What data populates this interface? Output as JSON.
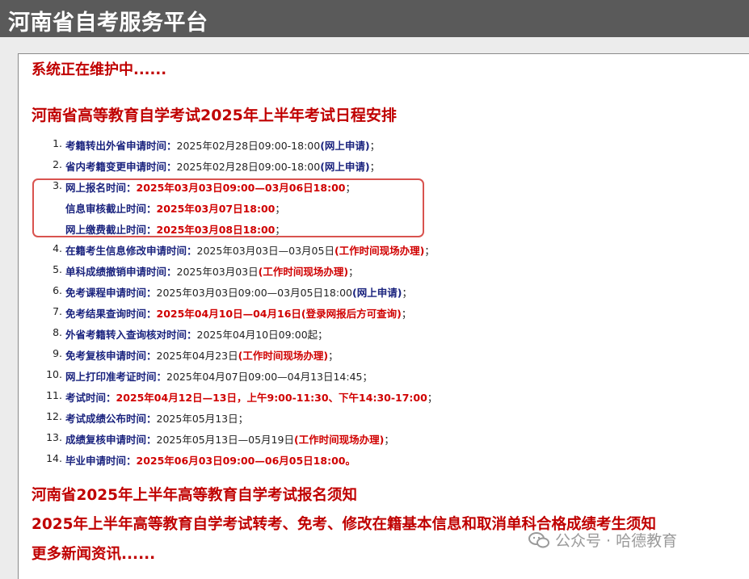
{
  "header": {
    "title": "河南省自考服务平台"
  },
  "notice": "系统正在维护中......",
  "schedule_title": "河南省高等教育自学考试2025年上半年考试日程安排",
  "schedule": [
    {
      "num": "1.",
      "label": "考籍转出外省申请时间：",
      "value": "2025年02月28日09:00-18:00",
      "note": "(网上申请)",
      "end": "；"
    },
    {
      "num": "2.",
      "label": "省内考籍变更申请时间：",
      "value": "2025年02月28日09:00-18:00",
      "note": "(网上申请)",
      "end": "；"
    },
    {
      "num": "3.",
      "label": "网上报名时间：",
      "value": "2025年03月03日09:00—03月06日18:00",
      "end": "；"
    },
    {
      "num": "",
      "label": "信息审核截止时间：",
      "value": "2025年03月07日18:00",
      "end": "；"
    },
    {
      "num": "",
      "label": "网上缴费截止时间：",
      "value": "2025年03月08日18:00",
      "end": "；"
    },
    {
      "num": "4.",
      "label": "在籍考生信息修改申请时间：",
      "value": "2025年03月03日—03月05日",
      "note": "(工作时间现场办理)",
      "end": "；"
    },
    {
      "num": "5.",
      "label": "单科成绩撤销申请时间：",
      "value": "2025年03月03日",
      "note": "(工作时间现场办理)",
      "end": "；"
    },
    {
      "num": "6.",
      "label": "免考课程申请时间：",
      "value": "2025年03月03日09:00—03月05日18:00",
      "note": "(网上申请)",
      "end": "；"
    },
    {
      "num": "7.",
      "label": "免考结果查询时间：",
      "value": "2025年04月10日—04月16日",
      "note": "(登录网报后方可查询)",
      "end": "；"
    },
    {
      "num": "8.",
      "label": "外省考籍转入查询核对时间：",
      "value": "2025年04月10日09:00起",
      "end": "；"
    },
    {
      "num": "9.",
      "label": "免考复核申请时间：",
      "value": "2025年04月23日",
      "note": "(工作时间现场办理)",
      "end": "；"
    },
    {
      "num": "10.",
      "label": "网上打印准考证时间：",
      "value": "2025年04月07日09:00—04月13日14:45",
      "end": "；"
    },
    {
      "num": "11.",
      "label": "考试时间：",
      "value": "2025年04月12日—13日，上午9:00-11:30、下午14:30-17:00",
      "end": "；"
    },
    {
      "num": "12.",
      "label": "考试成绩公布时间：",
      "value": "2025年05月13日",
      "end": "；"
    },
    {
      "num": "13.",
      "label": "成绩复核申请时间：",
      "value": "2025年05月13日—05月19日",
      "note": "(工作时间现场办理)",
      "end": "；"
    },
    {
      "num": "14.",
      "label": "毕业申请时间：",
      "value": "2025年06月03日09:00—06月05日18:00",
      "end": "。"
    }
  ],
  "links": [
    "河南省2025年上半年高等教育自学考试报名须知",
    "2025年上半年高等教育自学考试转考、免考、修改在籍基本信息和取消单科合格成绩考生须知",
    "更多新闻资讯......"
  ],
  "watermark": "公众号 · 哈德教育",
  "colors": {
    "header_bg": "#5a5a5a",
    "heading_red": "#c00000",
    "label_blue": "#1a237e",
    "highlight_box": "#d9534f"
  }
}
